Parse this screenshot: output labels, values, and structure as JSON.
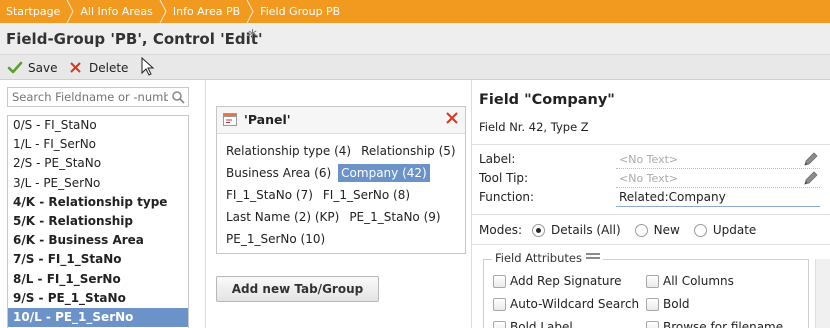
{
  "breadcrumb": {
    "items": [
      "Startpage",
      "All Info Areas",
      "Info Area PB",
      "Field Group PB"
    ]
  },
  "header": {
    "title": "Field-Group 'PB', Control 'Edit'",
    "modified_marker": "*"
  },
  "toolbar": {
    "save_label": "Save",
    "delete_label": "Delete"
  },
  "left": {
    "search_placeholder": "Search Fieldname or -number",
    "fields": [
      {
        "label": "0/S - FI_StaNo",
        "bold": false,
        "selected": false
      },
      {
        "label": "1/L - FI_SerNo",
        "bold": false,
        "selected": false
      },
      {
        "label": "2/S - PE_StaNo",
        "bold": false,
        "selected": false
      },
      {
        "label": "3/L - PE_SerNo",
        "bold": false,
        "selected": false
      },
      {
        "label": "4/K - Relationship type",
        "bold": true,
        "selected": false
      },
      {
        "label": "5/K - Relationship",
        "bold": true,
        "selected": false
      },
      {
        "label": "6/K - Business Area",
        "bold": true,
        "selected": false
      },
      {
        "label": "7/S - FI_1_StaNo",
        "bold": true,
        "selected": false
      },
      {
        "label": "8/L - FI_1_SerNo",
        "bold": true,
        "selected": false
      },
      {
        "label": "9/S - PE_1_StaNo",
        "bold": true,
        "selected": false
      },
      {
        "label": "10/L - PE_1_SerNo",
        "bold": true,
        "selected": true
      }
    ]
  },
  "panel": {
    "title": "'Panel'",
    "rows": [
      [
        {
          "label": "Relationship type (4)",
          "selected": false
        },
        {
          "label": "Relationship (5)",
          "selected": false
        }
      ],
      [
        {
          "label": "Business Area (6)",
          "selected": false
        },
        {
          "label": "Company (42)",
          "selected": true
        }
      ],
      [
        {
          "label": "FI_1_StaNo (7)",
          "selected": false
        },
        {
          "label": "FI_1_SerNo (8)",
          "selected": false
        }
      ],
      [
        {
          "label": "Last Name (2) (KP)",
          "selected": false
        },
        {
          "label": "PE_1_StaNo (9)",
          "selected": false
        }
      ],
      [
        {
          "label": "PE_1_SerNo (10)",
          "selected": false
        }
      ]
    ],
    "add_button": "Add new Tab/Group"
  },
  "details": {
    "field_title": "Field \"Company\"",
    "field_sub": "Field Nr. 42, Type Z",
    "label_label": "Label:",
    "label_value": "<No Text>",
    "tooltip_label": "Tool Tip:",
    "tooltip_value": "<No Text>",
    "function_label": "Function:",
    "function_value": "Related:Company",
    "modes_label": "Modes:",
    "modes": [
      {
        "label": "Details (All)",
        "checked": true
      },
      {
        "label": "New",
        "checked": false
      },
      {
        "label": "Update",
        "checked": false
      }
    ],
    "attributes_label": "Field Attributes",
    "attributes": [
      "Add Rep Signature",
      "All Columns",
      "Auto-Wildcard Search",
      "Bold",
      "Bold Label",
      "Browse for filename"
    ]
  },
  "colors": {
    "breadcrumb_bg": "#f29a1f",
    "selection": "#6b93c9",
    "delete_red": "#d9381e",
    "save_green": "#5aa02c"
  }
}
